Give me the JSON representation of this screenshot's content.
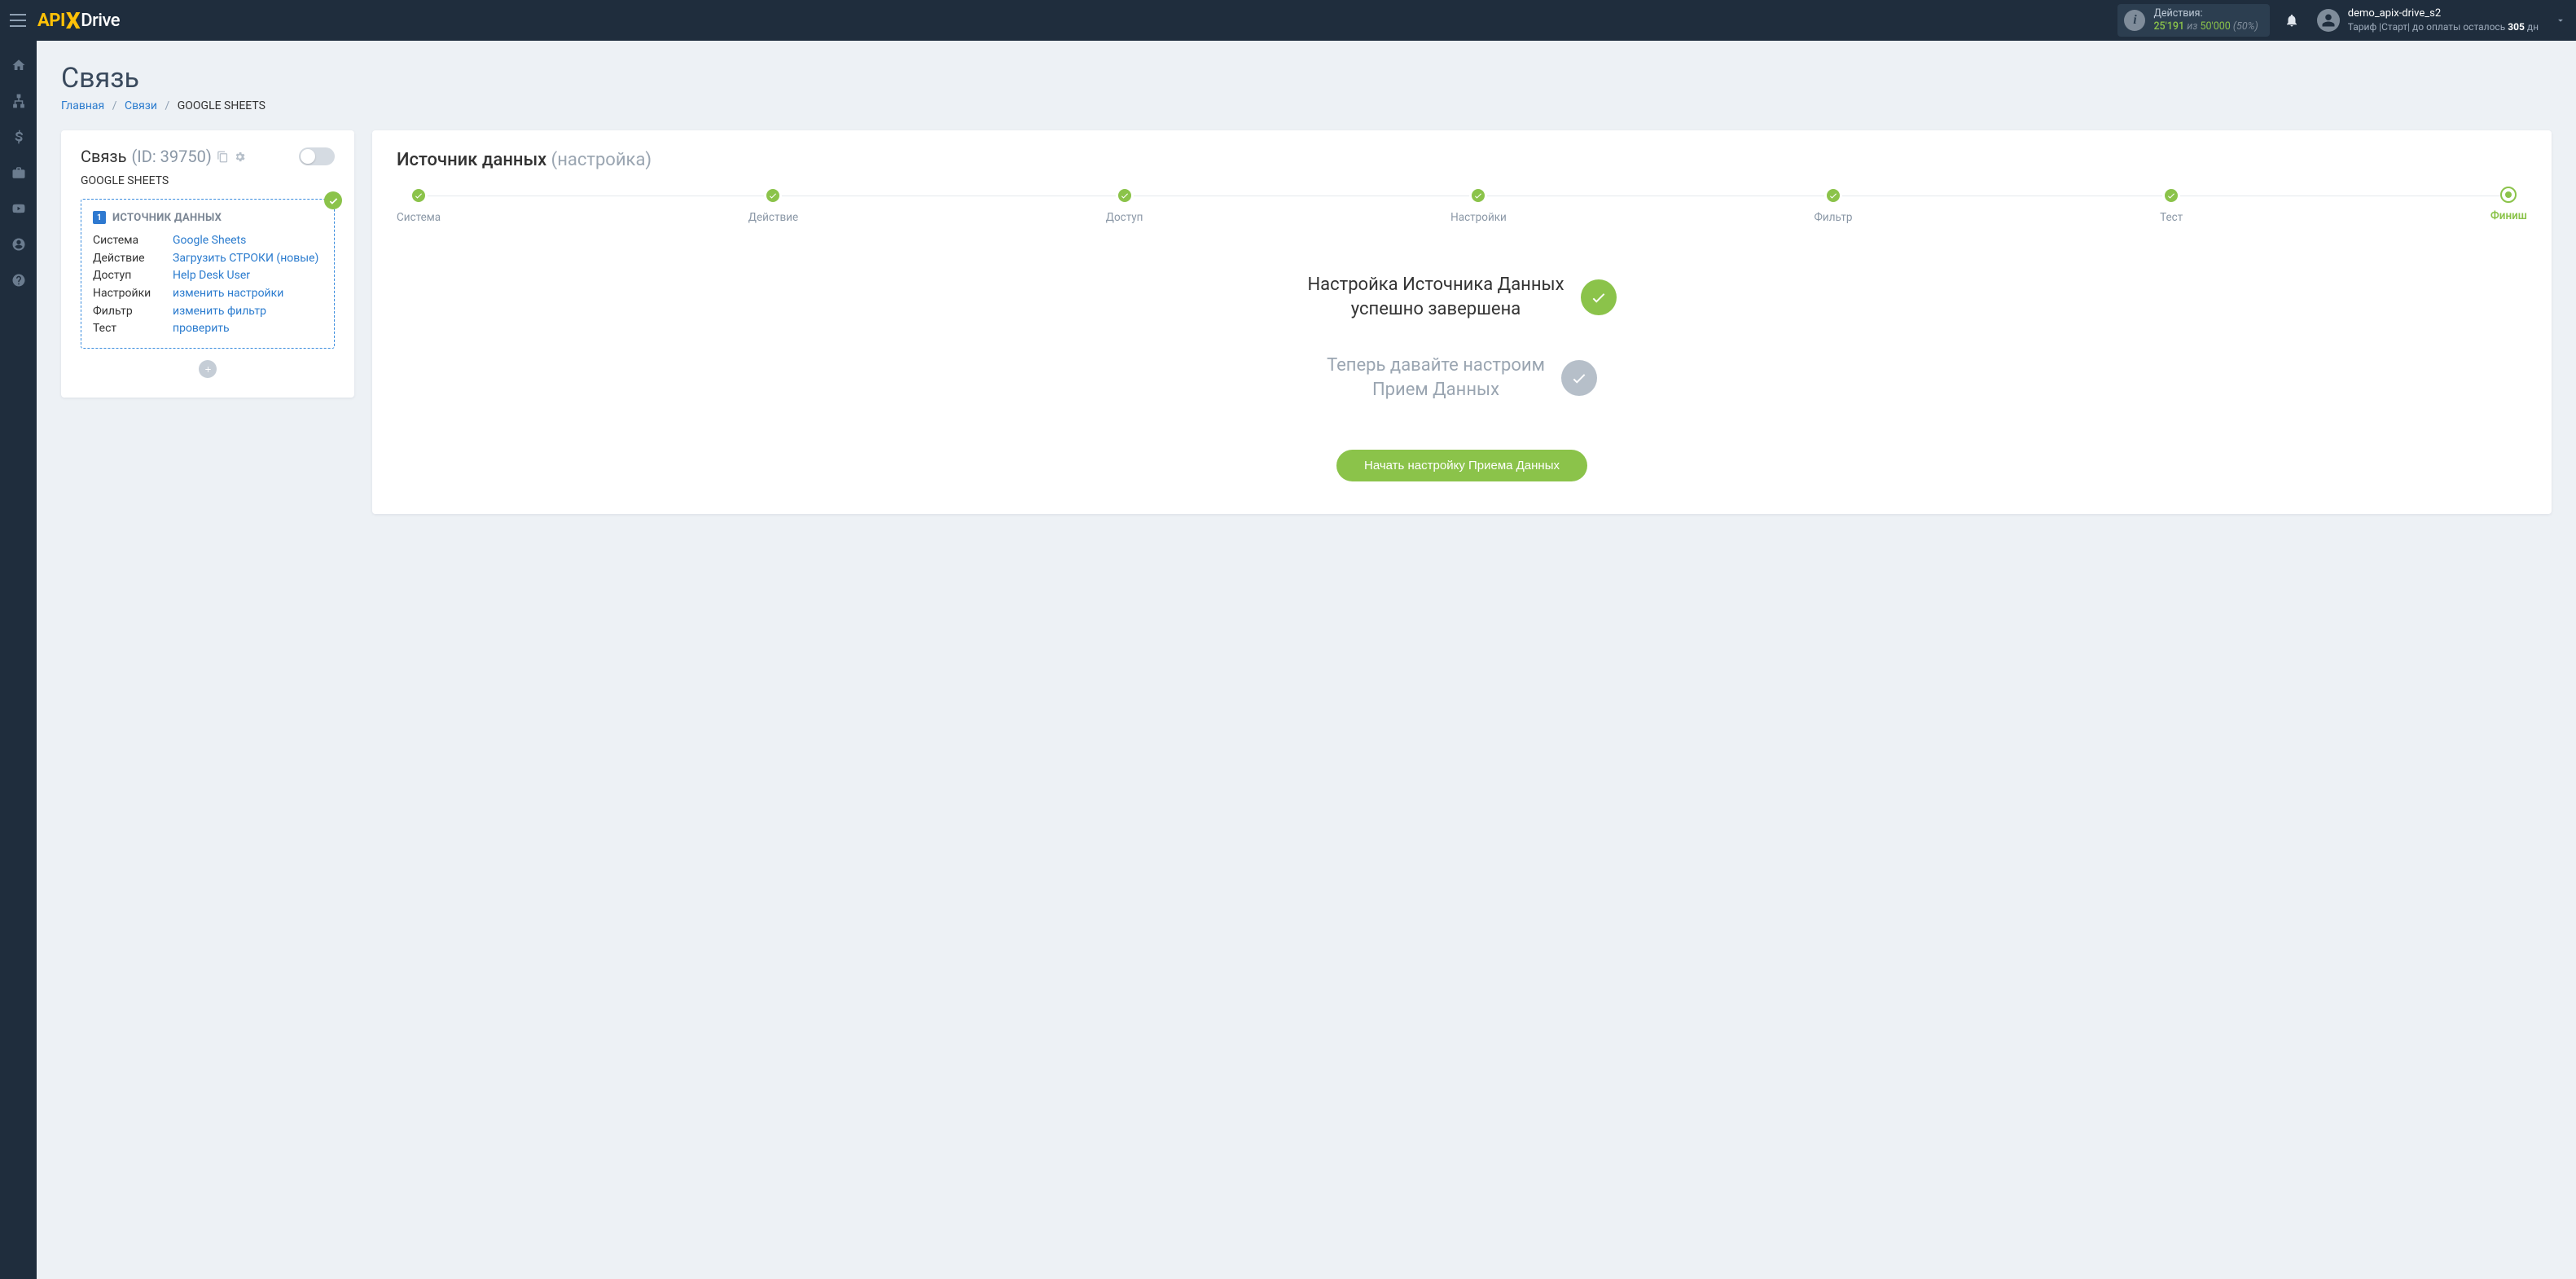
{
  "topbar": {
    "logo": {
      "api": "API",
      "x": "X",
      "drive": "Drive"
    },
    "actions": {
      "label": "Действия:",
      "used": "25'191",
      "of_word": "из",
      "total": "50'000",
      "percent": "(50%)"
    },
    "user": {
      "name": "demo_apix-drive_s2",
      "tariff_prefix": "Тариф |Старт| до оплаты осталось ",
      "tariff_days": "305",
      "tariff_suffix": " дн"
    }
  },
  "page": {
    "title": "Связь",
    "breadcrumb": {
      "home": "Главная",
      "links": "Связи",
      "current": "GOOGLE SHEETS"
    }
  },
  "side": {
    "title": "Связь",
    "id_label": "(ID: 39750)",
    "subtitle": "GOOGLE SHEETS",
    "source": {
      "heading": "ИСТОЧНИК ДАННЫХ",
      "number": "1",
      "rows": [
        {
          "k": "Система",
          "v": "Google Sheets"
        },
        {
          "k": "Действие",
          "v": "Загрузить СТРОКИ (новые)"
        },
        {
          "k": "Доступ",
          "v": "Help Desk User"
        },
        {
          "k": "Настройки",
          "v": "изменить настройки"
        },
        {
          "k": "Фильтр",
          "v": "изменить фильтр"
        },
        {
          "k": "Тест",
          "v": "проверить"
        }
      ]
    }
  },
  "main": {
    "title": "Источник данных",
    "title_sub": "(настройка)",
    "steps": [
      {
        "label": "Система"
      },
      {
        "label": "Действие"
      },
      {
        "label": "Доступ"
      },
      {
        "label": "Настройки"
      },
      {
        "label": "Фильтр"
      },
      {
        "label": "Тест"
      },
      {
        "label": "Финиш"
      }
    ],
    "status1_l1": "Настройка Источника Данных",
    "status1_l2": "успешно завершена",
    "status2_l1": "Теперь давайте настроим",
    "status2_l2": "Прием Данных",
    "cta": "Начать настройку Приема Данных"
  },
  "leftrail": {
    "items": [
      "home",
      "sitemap",
      "dollar",
      "briefcase",
      "youtube",
      "user",
      "question"
    ]
  }
}
